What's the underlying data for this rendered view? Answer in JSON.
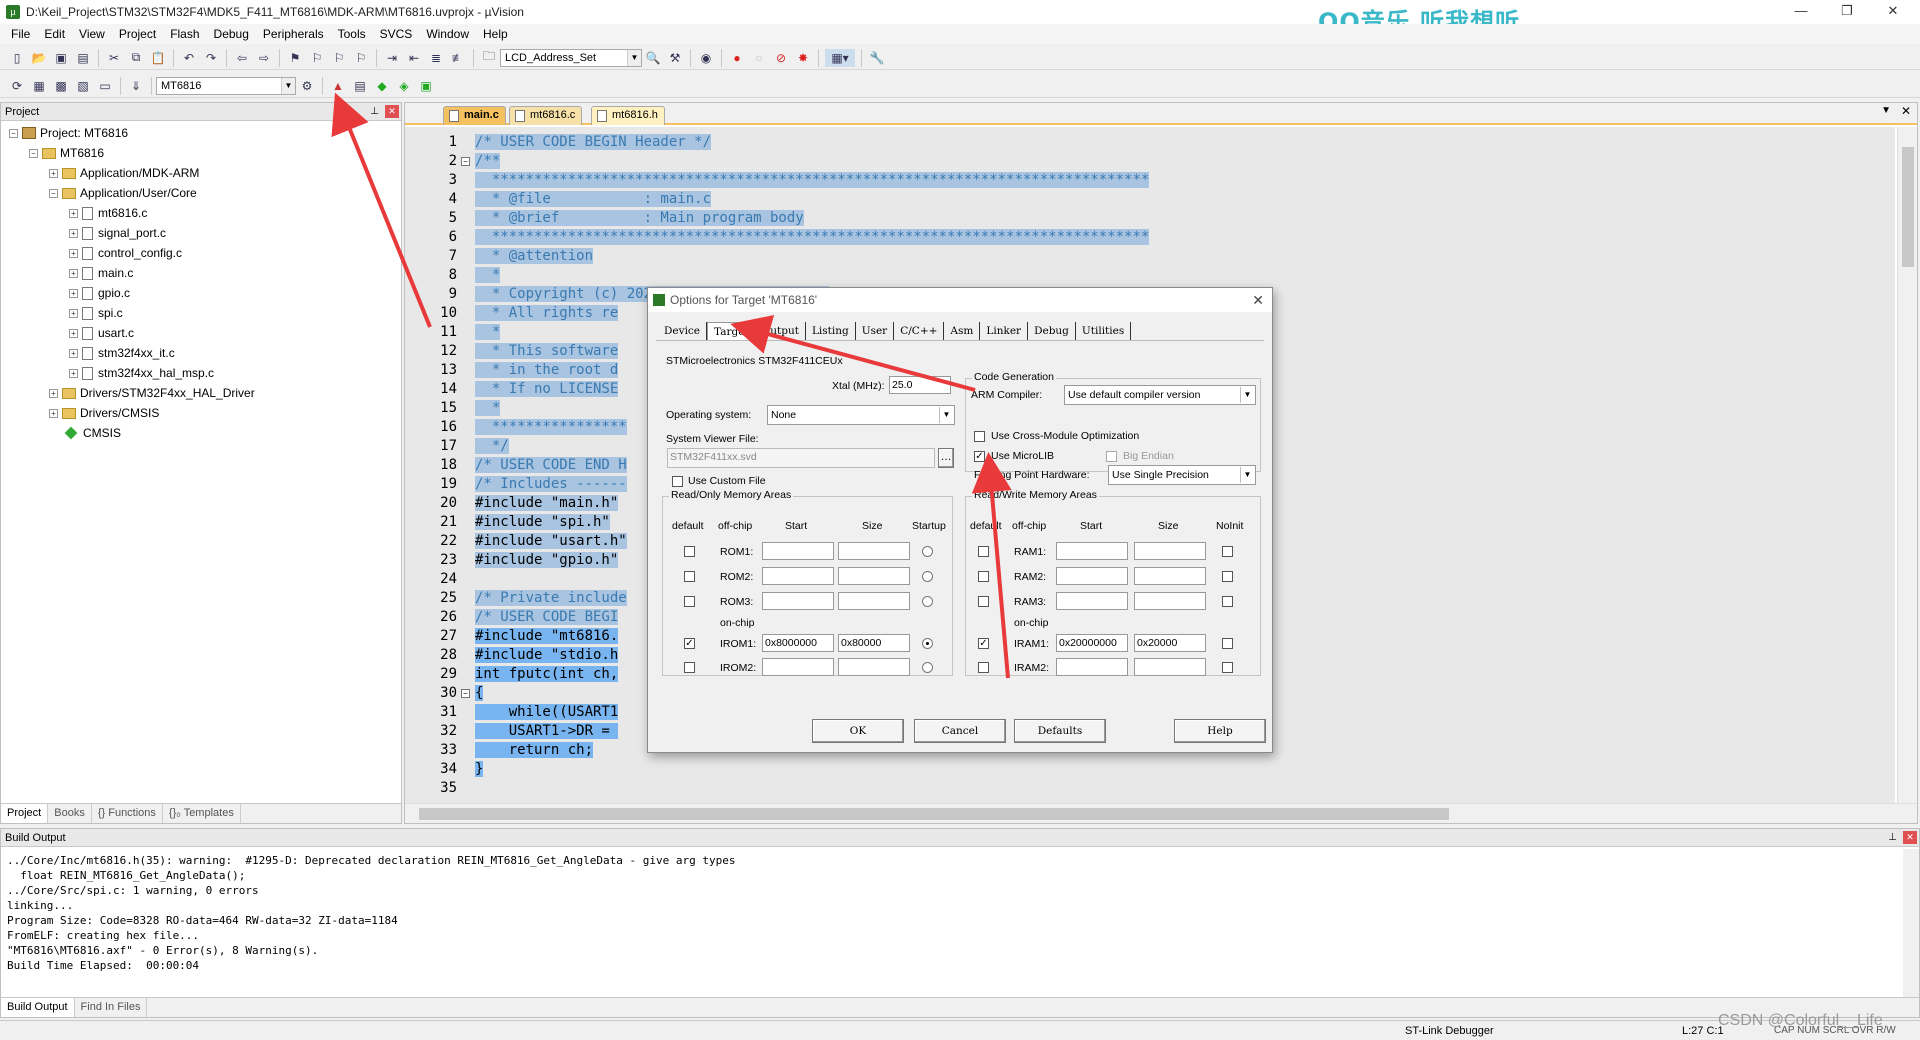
{
  "window": {
    "title": "D:\\Keil_Project\\STM32\\STM32F4\\MDK5_F411_MT6816\\MDK-ARM\\MT6816.uvprojx - µVision",
    "overlay_text": "QQ音乐 听我想听"
  },
  "menu": [
    "File",
    "Edit",
    "View",
    "Project",
    "Flash",
    "Debug",
    "Peripherals",
    "Tools",
    "SVCS",
    "Window",
    "Help"
  ],
  "toolbar1": {
    "find_combo": "LCD_Address_Set"
  },
  "toolbar2": {
    "target_combo": "MT6816"
  },
  "project_panel": {
    "title": "Project",
    "root": "Project: MT6816",
    "target": "MT6816",
    "groups": [
      {
        "label": "Application/MDK-ARM",
        "expanded": false
      },
      {
        "label": "Application/User/Core",
        "expanded": true,
        "files": [
          "mt6816.c",
          "signal_port.c",
          "control_config.c",
          "main.c",
          "gpio.c",
          "spi.c",
          "usart.c",
          "stm32f4xx_it.c",
          "stm32f4xx_hal_msp.c"
        ]
      },
      {
        "label": "Drivers/STM32F4xx_HAL_Driver",
        "expanded": false
      },
      {
        "label": "Drivers/CMSIS",
        "expanded": false
      }
    ],
    "cmsis": "CMSIS",
    "tabs": [
      "Project",
      "Books",
      "{} Functions",
      "{}₀ Templates"
    ]
  },
  "editor": {
    "tabs": [
      "main.c",
      "mt6816.c",
      "mt6816.h"
    ],
    "active_tab": "main.c",
    "lines": [
      {
        "n": "1",
        "t": "/* USER CODE BEGIN Header */",
        "k": "c"
      },
      {
        "n": "2",
        "t": "/**",
        "k": "c"
      },
      {
        "n": "3",
        "t": "  ******************************************************************************",
        "k": "c"
      },
      {
        "n": "4",
        "t": "  * @file           : main.c",
        "k": "c"
      },
      {
        "n": "5",
        "t": "  * @brief          : Main program body",
        "k": "c"
      },
      {
        "n": "6",
        "t": "  ******************************************************************************",
        "k": "c"
      },
      {
        "n": "7",
        "t": "  * @attention",
        "k": "c"
      },
      {
        "n": "8",
        "t": "  *",
        "k": "c"
      },
      {
        "n": "9",
        "t": "  * Copyright (c) 2023 STMicroelectronics.",
        "k": "c"
      },
      {
        "n": "10",
        "t": "  * All rights re",
        "k": "c"
      },
      {
        "n": "11",
        "t": "  *",
        "k": "c"
      },
      {
        "n": "12",
        "t": "  * This software",
        "k": "c"
      },
      {
        "n": "13",
        "t": "  * in the root d",
        "k": "c"
      },
      {
        "n": "14",
        "t": "  * If no LICENSE",
        "k": "c"
      },
      {
        "n": "15",
        "t": "  *",
        "k": "c"
      },
      {
        "n": "16",
        "t": "  ****************",
        "k": "c"
      },
      {
        "n": "17",
        "t": "  */",
        "k": "c"
      },
      {
        "n": "18",
        "t": "/* USER CODE END H",
        "k": "c"
      },
      {
        "n": "19",
        "t": "/* Includes ------",
        "k": "c"
      },
      {
        "n": "20",
        "t": "#include \"main.h\"",
        "k": "k"
      },
      {
        "n": "21",
        "t": "#include \"spi.h\"",
        "k": "k"
      },
      {
        "n": "22",
        "t": "#include \"usart.h\"",
        "k": "k"
      },
      {
        "n": "23",
        "t": "#include \"gpio.h\"",
        "k": "k"
      },
      {
        "n": "24",
        "t": "",
        "k": "k"
      },
      {
        "n": "25",
        "t": "/* Private include",
        "k": "c"
      },
      {
        "n": "26",
        "t": "/* USER CODE BEGI",
        "k": "c"
      },
      {
        "n": "27",
        "t": "#include \"mt6816.",
        "k": "d"
      },
      {
        "n": "28",
        "t": "#include \"stdio.h",
        "k": "d"
      },
      {
        "n": "29",
        "t": "int fputc(int ch,",
        "k": "d"
      },
      {
        "n": "30",
        "t": "{",
        "k": "d"
      },
      {
        "n": "31",
        "t": "    while((USART1",
        "k": "d"
      },
      {
        "n": "32",
        "t": "    USART1->DR = ",
        "k": "d"
      },
      {
        "n": "33",
        "t": "    return ch;",
        "k": "d"
      },
      {
        "n": "34",
        "t": "}",
        "k": "d"
      },
      {
        "n": "35",
        "t": "",
        "k": "d"
      }
    ]
  },
  "build_output": {
    "title": "Build Output",
    "text": "../Core/Inc/mt6816.h(35): warning:  #1295-D: Deprecated declaration REIN_MT6816_Get_AngleData - give arg types\n  float REIN_MT6816_Get_AngleData();\n../Core/Src/spi.c: 1 warning, 0 errors\nlinking...\nProgram Size: Code=8328 RO-data=464 RW-data=32 ZI-data=1184\nFromELF: creating hex file...\n\"MT6816\\MT6816.axf\" - 0 Error(s), 8 Warning(s).\nBuild Time Elapsed:  00:00:04",
    "tabs": [
      "Build Output",
      "Find In Files"
    ]
  },
  "status": {
    "debugger": "ST-Link Debugger",
    "position": "L:27 C:1",
    "keys": "CAP  NUM  SCRL  OVR  R/W"
  },
  "watermark": "CSDN @Colorful__Life",
  "dialog": {
    "title": "Options for Target 'MT6816'",
    "tabs": [
      "Device",
      "Target",
      "Output",
      "Listing",
      "User",
      "C/C++",
      "Asm",
      "Linker",
      "Debug",
      "Utilities"
    ],
    "active_tab": "Target",
    "device": "STMicroelectronics STM32F411CEUx",
    "xtal_label": "Xtal (MHz):",
    "xtal_value": "25.0",
    "os_label": "Operating system:",
    "os_value": "None",
    "svd_label": "System Viewer File:",
    "svd_value": "STM32F411xx.svd",
    "custom_file": "Use Custom File",
    "codegen_title": "Code Generation",
    "compiler_label": "ARM Compiler:",
    "compiler_value": "Use default compiler version",
    "cross_module": "Use Cross-Module Optimization",
    "microlib": "Use MicroLIB",
    "microlib_checked": true,
    "big_endian": "Big Endian",
    "fpu_label": "Floating Point Hardware:",
    "fpu_value": "Use Single Precision",
    "ro_title": "Read/Only Memory Areas",
    "rw_title": "Read/Write Memory Areas",
    "hdr_default": "default",
    "hdr_offchip": "off-chip",
    "hdr_start": "Start",
    "hdr_size": "Size",
    "hdr_startup": "Startup",
    "hdr_noinit": "NoInit",
    "onchip": "on-chip",
    "rom": [
      {
        "label": "ROM1:",
        "start": "",
        "size": ""
      },
      {
        "label": "ROM2:",
        "start": "",
        "size": ""
      },
      {
        "label": "ROM3:",
        "start": "",
        "size": ""
      },
      {
        "label": "IROM1:",
        "start": "0x8000000",
        "size": "0x80000"
      },
      {
        "label": "IROM2:",
        "start": "",
        "size": ""
      }
    ],
    "ram": [
      {
        "label": "RAM1:",
        "start": "",
        "size": ""
      },
      {
        "label": "RAM2:",
        "start": "",
        "size": ""
      },
      {
        "label": "RAM3:",
        "start": "",
        "size": ""
      },
      {
        "label": "IRAM1:",
        "start": "0x20000000",
        "size": "0x20000"
      },
      {
        "label": "IRAM2:",
        "start": "",
        "size": ""
      }
    ],
    "buttons": {
      "ok": "OK",
      "cancel": "Cancel",
      "defaults": "Defaults",
      "help": "Help"
    }
  },
  "colors": {
    "annotation_arrow": "#e83a3a",
    "selection": "#a8c4e0",
    "selection_dark": "#78b4f0",
    "comment": "#3a7ab0"
  }
}
